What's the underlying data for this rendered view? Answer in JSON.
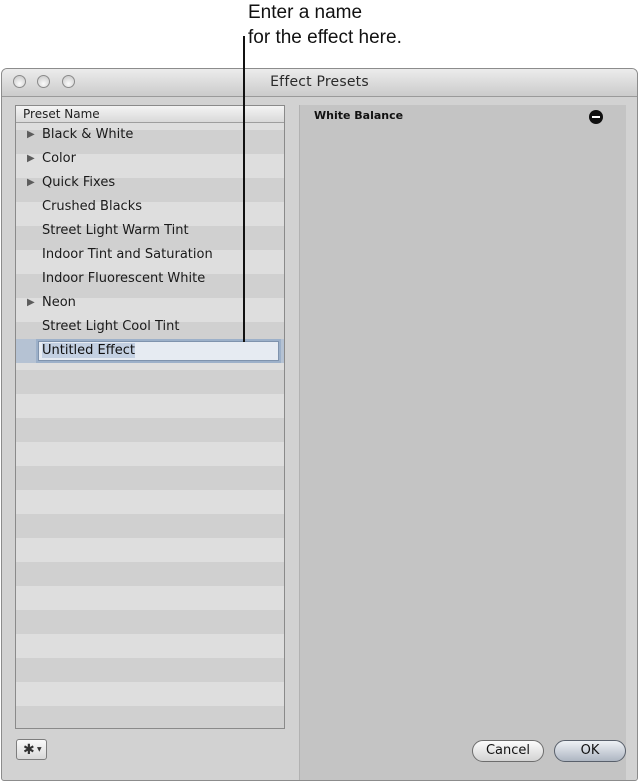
{
  "annotation": {
    "line1": "Enter a name",
    "line2": "for the effect here."
  },
  "window": {
    "title": "Effect Presets"
  },
  "presets": {
    "header": "Preset Name",
    "items": [
      {
        "label": "Black & White",
        "has_children": true
      },
      {
        "label": "Color",
        "has_children": true
      },
      {
        "label": "Quick Fixes",
        "has_children": true
      },
      {
        "label": "Crushed Blacks",
        "has_children": false
      },
      {
        "label": "Street Light Warm Tint",
        "has_children": false
      },
      {
        "label": "Indoor Tint and Saturation",
        "has_children": false
      },
      {
        "label": "Indoor Fluorescent White",
        "has_children": false
      },
      {
        "label": "Neon",
        "has_children": true
      },
      {
        "label": "Street Light Cool Tint",
        "has_children": false
      }
    ],
    "editing": {
      "value": "Untitled Effect"
    }
  },
  "effects": {
    "items": [
      {
        "label": "White Balance",
        "action_icon": "remove-icon"
      }
    ]
  },
  "footer": {
    "action_icon": "gear-icon",
    "cancel_label": "Cancel",
    "ok_label": "OK"
  },
  "colors": {
    "window_background": "#d2d2d2",
    "selection": "#b5c2d3",
    "effect_panel": "#c4c4c4"
  }
}
